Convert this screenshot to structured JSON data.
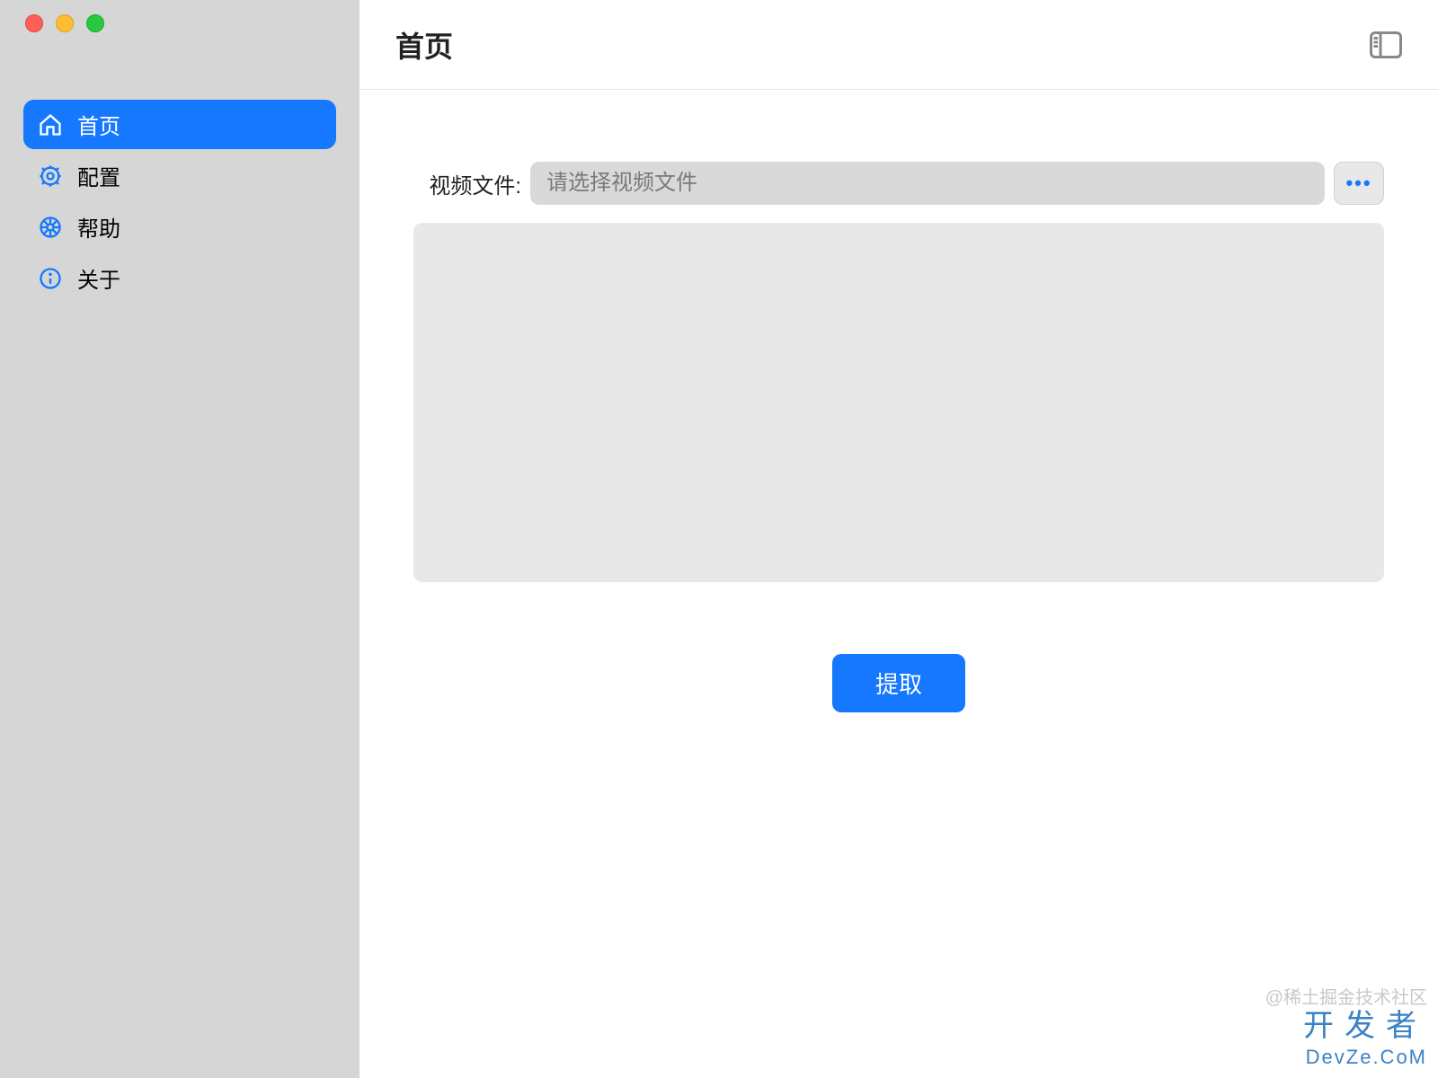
{
  "header": {
    "title": "首页"
  },
  "sidebar": {
    "items": [
      {
        "label": "首页",
        "icon": "home-icon",
        "active": true
      },
      {
        "label": "配置",
        "icon": "gear-icon",
        "active": false
      },
      {
        "label": "帮助",
        "icon": "wheel-icon",
        "active": false
      },
      {
        "label": "关于",
        "icon": "info-icon",
        "active": false
      }
    ]
  },
  "form": {
    "file_label": "视频文件:",
    "file_placeholder": "请选择视频文件",
    "file_value": "",
    "browse_label": "•••",
    "submit_label": "提取"
  },
  "watermark": {
    "source": "@稀土掘金技术社区",
    "brand": "开发者",
    "domain": "DevZe.CoM"
  }
}
